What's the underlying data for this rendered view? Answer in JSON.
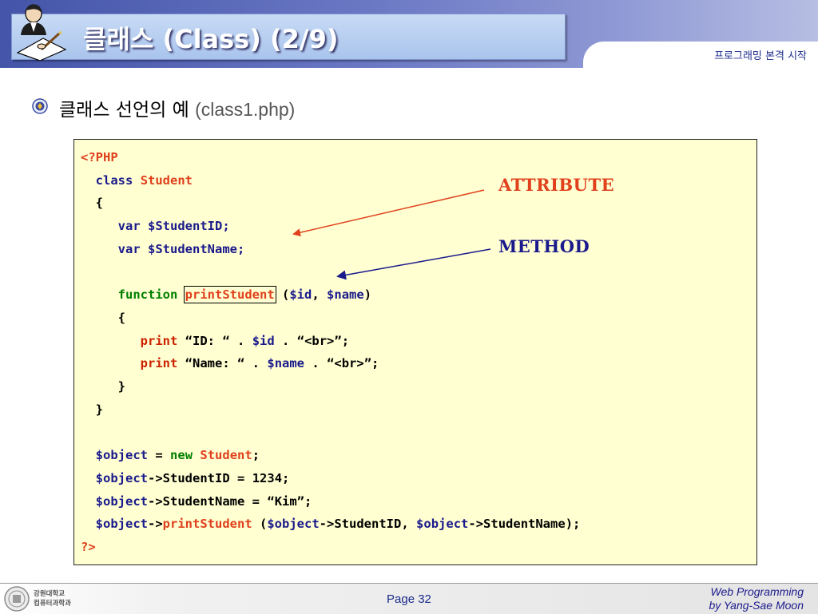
{
  "header": {
    "title": "클래스 (Class) (2/9)",
    "subtitle": "프로그래밍 본격 시작"
  },
  "bullet": {
    "text": "클래스 선언의 예",
    "file": "(class1.php)"
  },
  "code": {
    "open_tag": "<?PHP",
    "kw_class": "class",
    "class_name": "Student",
    "brace_open": "{",
    "brace_close": "}",
    "kw_var": "var",
    "attr_id": "$StudentID;",
    "attr_name": "$StudentName;",
    "kw_function": "function",
    "method_name": "printStudent",
    "paren_open": "(",
    "param_id": "$id",
    "comma": ",",
    "param_name": "$name",
    "paren_close": ")",
    "kw_print": "print",
    "print1_str": "“ID: “",
    "dot": ".",
    "br_str": "“<br>”;",
    "print2_str": "“Name: “",
    "obj_var": "$object",
    "assign": "=",
    "kw_new": "new",
    "semicolon": ";",
    "arrow": "->",
    "prop_id": "StudentID",
    "prop_name": "StudentName",
    "val_id": "1234;",
    "val_name": "“Kim”;",
    "end_call": ");",
    "close_tag": "?>"
  },
  "annotations": {
    "attribute": "ATTRIBUTE",
    "method": "METHOD",
    "attribute_color": "#e0401c",
    "method_color": "#1a1a8c"
  },
  "footer": {
    "univ_line1": "강원대학교",
    "univ_line2": "컴퓨터과학과",
    "page": "Page 32",
    "course": "Web Programming",
    "author": "by Yang-Sae Moon"
  }
}
